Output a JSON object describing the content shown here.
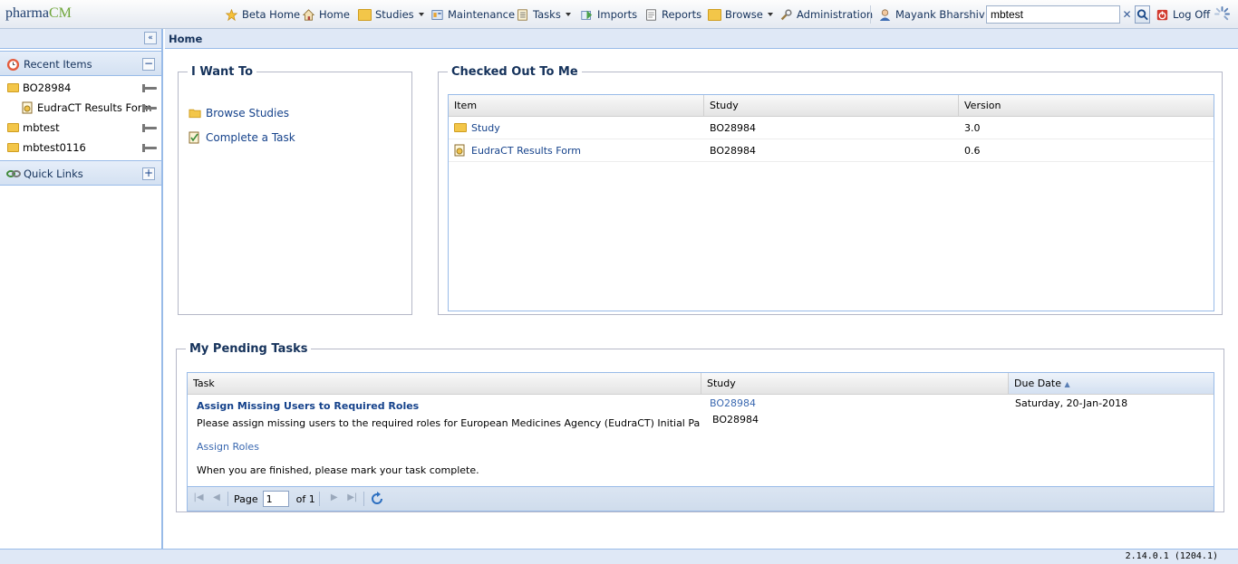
{
  "app": {
    "logo_a": "pharma",
    "logo_b": "CM"
  },
  "topnav": {
    "beta_home": "Beta Home",
    "home": "Home",
    "studies": "Studies",
    "maintenance": "Maintenance",
    "tasks": "Tasks",
    "imports": "Imports",
    "reports": "Reports",
    "browse": "Browse",
    "administration": "Administration",
    "user": "Mayank Bharshiv",
    "search_value": "mbtest",
    "logoff": "Log Off"
  },
  "sidebar": {
    "recent_title": "Recent Items",
    "recent_items": [
      {
        "label": "BO28984"
      },
      {
        "label": "EudraCT Results Form"
      },
      {
        "label": "mbtest"
      },
      {
        "label": "mbtest0116"
      }
    ],
    "quick_links_title": "Quick Links"
  },
  "breadcrumb": "Home",
  "i_want_to": {
    "title": "I Want To",
    "links": [
      "Browse Studies",
      "Complete a Task"
    ]
  },
  "checked_out": {
    "title": "Checked Out To Me",
    "columns": [
      "Item",
      "Study",
      "Version"
    ],
    "rows": [
      {
        "item": "Study",
        "study": "BO28984",
        "version": "3.0"
      },
      {
        "item": "EudraCT Results Form",
        "study": "BO28984",
        "version": "0.6"
      }
    ]
  },
  "pending": {
    "title": "My Pending Tasks",
    "columns": [
      "Task",
      "Study",
      "Due Date"
    ],
    "task_title": "Assign Missing Users to Required Roles",
    "task_desc": "Please assign missing users to the required roles for European Medicines Agency (EudraCT) Initial Pan-European C",
    "task_link": "Assign Roles",
    "task_note": "When you are finished, please mark your task complete.",
    "study_link": "BO28984",
    "study_text": "BO28984",
    "due_date": "Saturday, 20-Jan-2018",
    "pager_page": "Page",
    "pager_value": "1",
    "pager_of": "of 1"
  },
  "footer": {
    "version": "2.14.0.1 (1204.1)"
  },
  "colors": {
    "accent": "#15428b",
    "header_bg": "#dfe8f6",
    "border": "#99bbe8"
  }
}
